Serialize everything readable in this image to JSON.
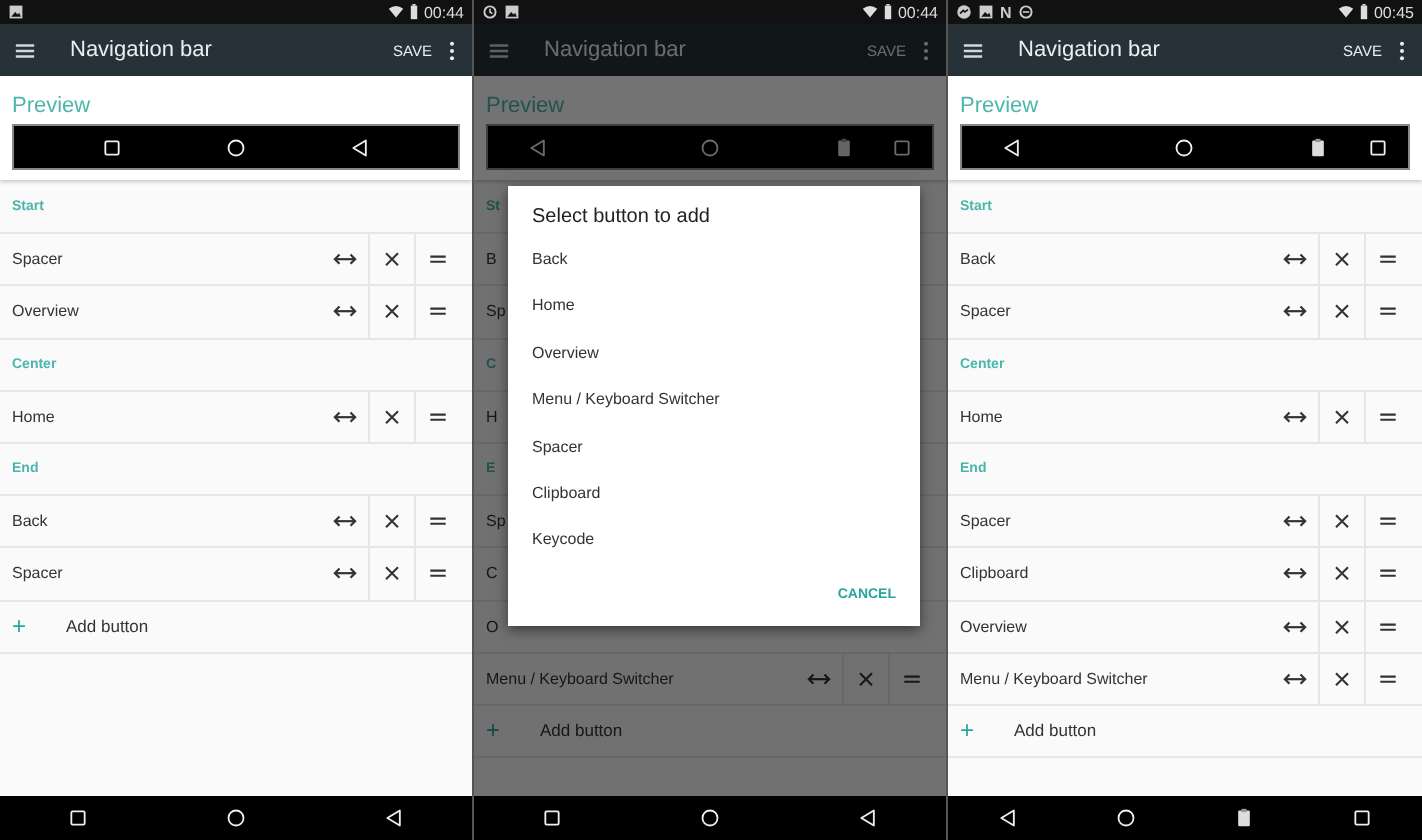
{
  "panels": [
    {
      "status_bar": {
        "left_icons": [
          {
            "kind": "picture"
          }
        ],
        "time": "00:44"
      },
      "toolbar": {
        "title": "Navigation bar",
        "action": "SAVE"
      },
      "preview": {
        "title": "Preview",
        "sections": [
          [
            {
              "kind": "spacer"
            },
            {
              "kind": "overview"
            }
          ],
          [
            {
              "kind": "home"
            }
          ],
          [
            {
              "kind": "back"
            },
            {
              "kind": "spacer"
            }
          ]
        ]
      },
      "rows": [
        {
          "kind": "header",
          "label": "Start"
        },
        {
          "kind": "item",
          "label": "Spacer"
        },
        {
          "kind": "item",
          "label": "Overview"
        },
        {
          "kind": "header",
          "label": "Center"
        },
        {
          "kind": "item",
          "label": "Home"
        },
        {
          "kind": "header",
          "label": "End"
        },
        {
          "kind": "item",
          "label": "Back"
        },
        {
          "kind": "item",
          "label": "Spacer"
        },
        {
          "kind": "add",
          "icon": "+",
          "label": "Add button"
        }
      ],
      "system_nav": [
        {
          "kind": "overview"
        },
        {
          "kind": "home"
        },
        {
          "kind": "back"
        }
      ]
    },
    {
      "status_bar": {
        "left_icons": [
          {
            "kind": "history"
          },
          {
            "kind": "picture"
          }
        ],
        "time": "00:44"
      },
      "toolbar": {
        "title": "Navigation bar",
        "action": "SAVE"
      },
      "preview": {
        "title": "Preview",
        "sections": [
          [
            {
              "kind": "back"
            },
            {
              "kind": "spacer"
            }
          ],
          [
            {
              "kind": "home"
            }
          ],
          [
            {
              "kind": "spacer"
            },
            {
              "kind": "clipboard"
            },
            {
              "kind": "overview"
            }
          ]
        ]
      },
      "rows": [
        {
          "kind": "header",
          "label": "St"
        },
        {
          "kind": "covered_item",
          "label": "B"
        },
        {
          "kind": "covered_item",
          "label": "Sp"
        },
        {
          "kind": "header",
          "label": "C"
        },
        {
          "kind": "covered_item",
          "label": "H"
        },
        {
          "kind": "header",
          "label": "E"
        },
        {
          "kind": "covered_item",
          "label": "Sp"
        },
        {
          "kind": "covered_item",
          "label": "C"
        },
        {
          "kind": "covered_item",
          "label": "O"
        },
        {
          "kind": "item",
          "label": "Menu / Keyboard Switcher"
        },
        {
          "kind": "add",
          "icon": "+",
          "label": "Add button"
        }
      ],
      "dialog": {
        "title": "Select button to add",
        "options": [
          "Back",
          "Home",
          "Overview",
          "Menu / Keyboard Switcher",
          "Spacer",
          "Clipboard",
          "Keycode"
        ],
        "action": "CANCEL"
      },
      "system_nav": [
        {
          "kind": "overview"
        },
        {
          "kind": "home"
        },
        {
          "kind": "back"
        }
      ]
    },
    {
      "status_bar": {
        "left_icons": [
          {
            "kind": "chat"
          },
          {
            "kind": "picture"
          },
          {
            "kind": "letter",
            "text": "N"
          },
          {
            "kind": "circle"
          }
        ],
        "time": "00:45"
      },
      "toolbar": {
        "title": "Navigation bar",
        "action": "SAVE"
      },
      "preview": {
        "title": "Preview",
        "sections": [
          [
            {
              "kind": "back"
            },
            {
              "kind": "spacer"
            }
          ],
          [
            {
              "kind": "home"
            }
          ],
          [
            {
              "kind": "spacer"
            },
            {
              "kind": "clipboard"
            },
            {
              "kind": "overview"
            }
          ]
        ]
      },
      "rows": [
        {
          "kind": "header",
          "label": "Start"
        },
        {
          "kind": "item",
          "label": "Back"
        },
        {
          "kind": "item",
          "label": "Spacer"
        },
        {
          "kind": "header",
          "label": "Center"
        },
        {
          "kind": "item",
          "label": "Home"
        },
        {
          "kind": "header",
          "label": "End"
        },
        {
          "kind": "item",
          "label": "Spacer"
        },
        {
          "kind": "item",
          "label": "Clipboard"
        },
        {
          "kind": "item",
          "label": "Overview"
        },
        {
          "kind": "item",
          "label": "Menu / Keyboard Switcher"
        },
        {
          "kind": "add",
          "icon": "+",
          "label": "Add button"
        }
      ],
      "system_nav": [
        {
          "kind": "back"
        },
        {
          "kind": "home"
        },
        {
          "kind": "clipboard"
        },
        {
          "kind": "overview"
        }
      ]
    }
  ]
}
